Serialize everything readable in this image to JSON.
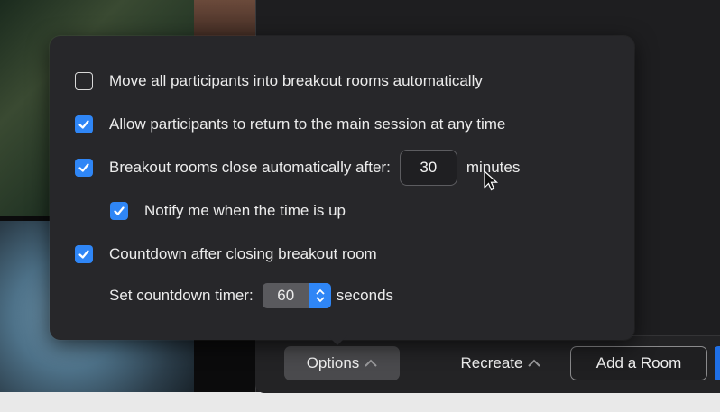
{
  "options_panel": {
    "items": [
      {
        "label": "Move all participants into breakout rooms automatically",
        "checked": false
      },
      {
        "label": "Allow participants to return to the main session at any time",
        "checked": true
      },
      {
        "label": "Breakout rooms close automatically after:",
        "checked": true,
        "value": "30",
        "unit": "minutes"
      },
      {
        "label": "Notify me when the time is up",
        "checked": true
      },
      {
        "label": "Countdown after closing breakout room",
        "checked": true
      }
    ],
    "countdown": {
      "label": "Set countdown timer:",
      "value": "60",
      "unit": "seconds"
    }
  },
  "footer": {
    "options_label": "Options",
    "recreate_label": "Recreate",
    "add_room_label": "Add a Room"
  },
  "colors": {
    "accent": "#2f86f6",
    "panel": "#27272a",
    "window": "#1e1e20"
  }
}
